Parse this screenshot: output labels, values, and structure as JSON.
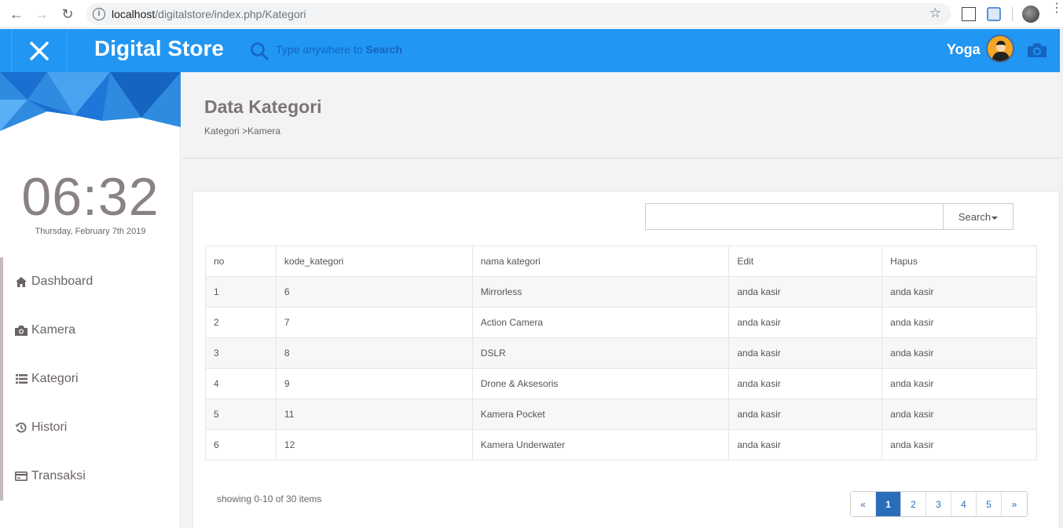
{
  "browser": {
    "url_host": "localhost",
    "url_path": "/digitalstore/index.php/Kategori"
  },
  "header": {
    "brand": "Digital Store",
    "search_prefix": "Type anywhere to ",
    "search_bold": "Search",
    "username": "Yoga"
  },
  "sidebar": {
    "clock": "06:32",
    "date": "Thursday, February 7th 2019",
    "items": [
      {
        "label": "Dashboard",
        "icon": "home-icon"
      },
      {
        "label": "Kamera",
        "icon": "camera-icon"
      },
      {
        "label": "Kategori",
        "icon": "list-icon"
      },
      {
        "label": "Histori",
        "icon": "history-icon"
      },
      {
        "label": "Transaksi",
        "icon": "credit-card-icon"
      }
    ]
  },
  "page": {
    "title": "Data Kategori",
    "breadcrumb": "Kategori >Kamera"
  },
  "table": {
    "search_button": "Search",
    "columns": [
      "no",
      "kode_kategori",
      "nama kategori",
      "Edit",
      "Hapus"
    ],
    "rows": [
      [
        "1",
        "6",
        "Mirrorless",
        "anda kasir",
        "anda kasir"
      ],
      [
        "2",
        "7",
        "Action Camera",
        "anda kasir",
        "anda kasir"
      ],
      [
        "3",
        "8",
        "DSLR",
        "anda kasir",
        "anda kasir"
      ],
      [
        "4",
        "9",
        "Drone & Aksesoris",
        "anda kasir",
        "anda kasir"
      ],
      [
        "5",
        "11",
        "Kamera Pocket",
        "anda kasir",
        "anda kasir"
      ],
      [
        "6",
        "12",
        "Kamera Underwater",
        "anda kasir",
        "anda kasir"
      ]
    ],
    "showing": "showing 0-10 of 30 items",
    "pagination": [
      "«",
      "1",
      "2",
      "3",
      "4",
      "5",
      "»"
    ],
    "active_page": "1"
  },
  "colors": {
    "appbar": "#2196f3",
    "accent": "#2a6ebb"
  }
}
